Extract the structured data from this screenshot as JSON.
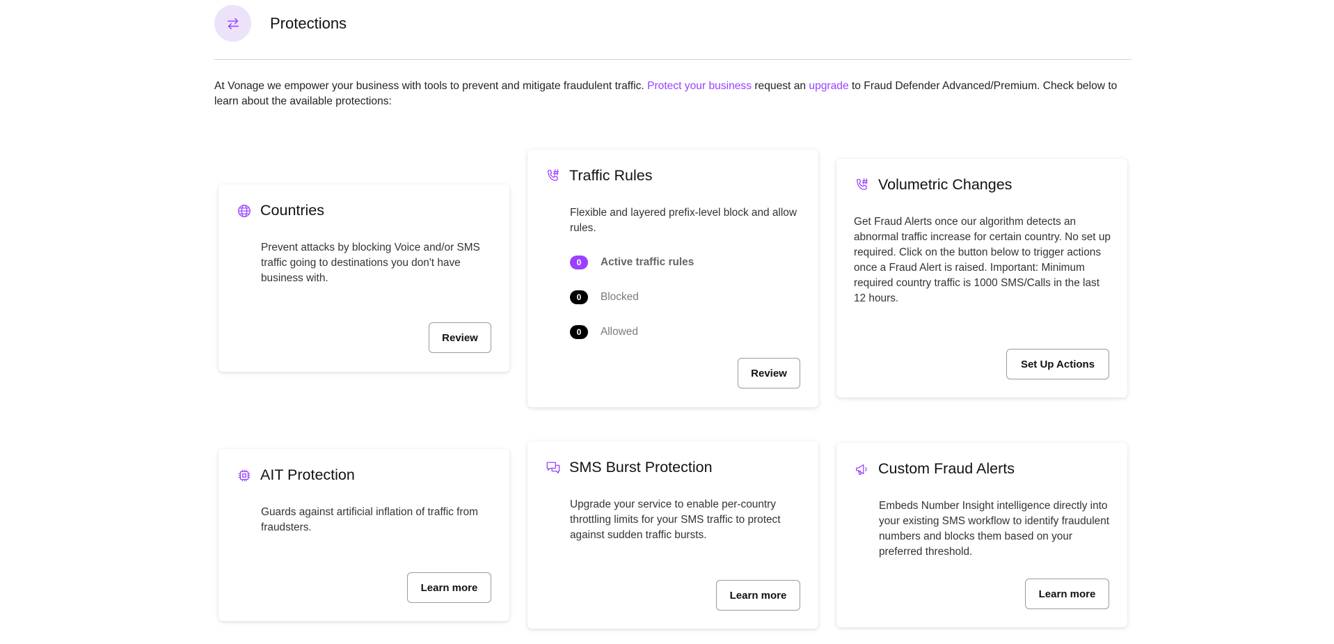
{
  "header": {
    "title": "Protections",
    "icon": "swap-arrows-icon"
  },
  "intro": {
    "text_before": "At Vonage we empower your business with tools to prevent and mitigate fraudulent traffic. ",
    "link_protect": "Protect your business",
    "text_middle": " request an ",
    "link_upgrade": "upgrade",
    "text_after": " to Fraud Defender Advanced/Premium. Check below to learn about the available protections:"
  },
  "colors": {
    "accent": "#9941ff",
    "badge_bg": "#ece3fb"
  },
  "cards": {
    "countries": {
      "icon": "globe-icon",
      "title": "Countries",
      "description": "Prevent attacks by blocking Voice and/or SMS traffic going to destinations you don't have business with.",
      "button": "Review"
    },
    "traffic_rules": {
      "icon": "phone-hash-icon",
      "title": "Traffic Rules",
      "description": "Flexible and layered prefix-level block and allow rules.",
      "rules": [
        {
          "count": "0",
          "label": "Active traffic rules"
        },
        {
          "count": "0",
          "label": "Blocked"
        },
        {
          "count": "0",
          "label": "Allowed"
        }
      ],
      "button": "Review"
    },
    "volumetric": {
      "icon": "phone-hash-icon",
      "title": "Volumetric Changes",
      "description": "Get Fraud Alerts once our algorithm detects an abnormal traffic increase for certain country. No set up required. Click on the button below to trigger actions once a Fraud Alert is raised. Important: Minimum required country traffic is 1000 SMS/Calls in the last 12 hours.",
      "button": "Set Up Actions"
    },
    "ait": {
      "icon": "chip-icon",
      "title": "AIT Protection",
      "description": "Guards against artificial inflation of traffic from fraudsters.",
      "button": "Learn more"
    },
    "sms_burst": {
      "icon": "chat-bubbles-icon",
      "title": "SMS Burst Protection",
      "description": "Upgrade your service to enable per-country throttling limits for your SMS traffic to protect against sudden traffic bursts.",
      "button": "Learn more"
    },
    "custom_alerts": {
      "icon": "megaphone-icon",
      "title": "Custom Fraud Alerts",
      "description": "Embeds Number Insight intelligence directly into your existing SMS workflow to identify fraudulent numbers and blocks them based on your preferred threshold.",
      "button": "Learn more"
    }
  }
}
